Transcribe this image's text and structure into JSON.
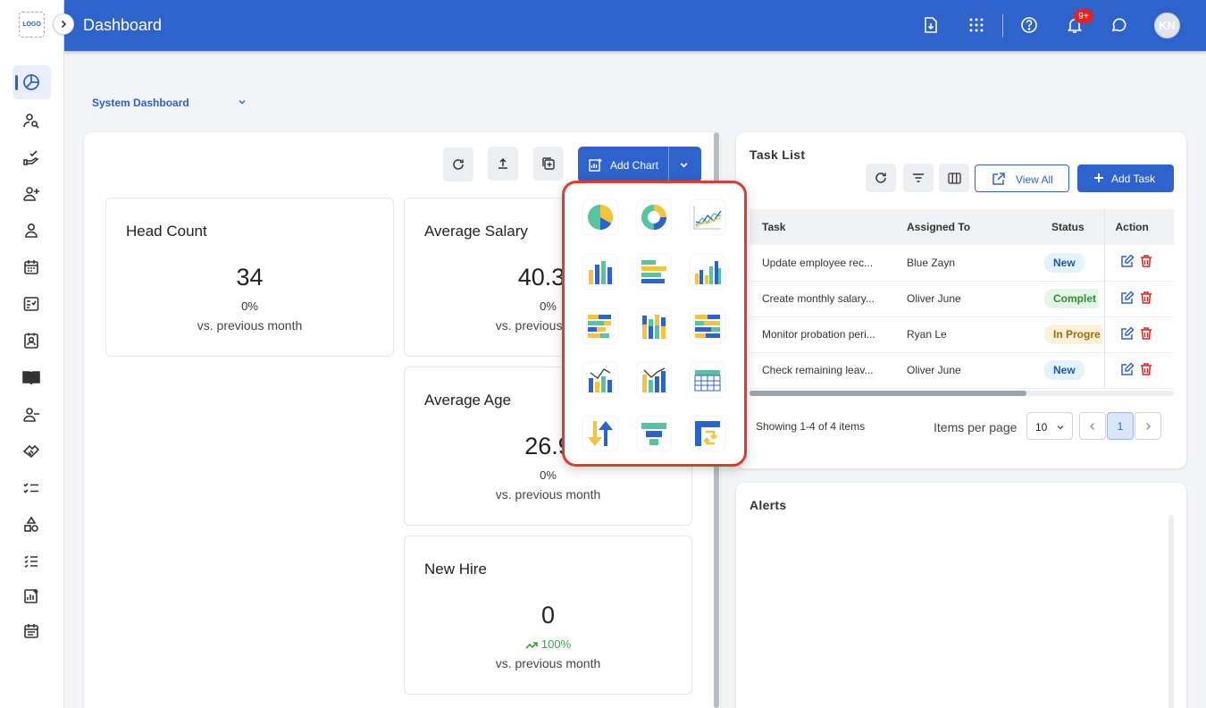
{
  "app": {
    "logo_text": "LOGO",
    "page_title": "Dashboard",
    "notification_count": "9+",
    "avatar_initials": "KN",
    "accent_color": "#2f63cc"
  },
  "sidebar": {
    "items": [
      {
        "name": "dashboard-icon",
        "active": true
      },
      {
        "name": "employee-search-icon"
      },
      {
        "name": "onboarding-icon"
      },
      {
        "name": "add-person-icon"
      },
      {
        "name": "person-icon"
      },
      {
        "name": "calendar-icon"
      },
      {
        "name": "checklist-doc-icon"
      },
      {
        "name": "contact-card-icon"
      },
      {
        "name": "book-icon"
      },
      {
        "name": "remove-person-icon"
      },
      {
        "name": "handshake-icon"
      },
      {
        "name": "task-list-icon"
      },
      {
        "name": "shapes-icon"
      },
      {
        "name": "list-check-icon"
      },
      {
        "name": "chart-add-icon"
      },
      {
        "name": "schedule-icon"
      }
    ]
  },
  "dashboard": {
    "selector_label": "System Dashboard",
    "add_chart_label": "Add Chart",
    "stats": [
      {
        "title": "Head Count",
        "value": "34",
        "pct": "0%",
        "sub": "vs. previous month"
      },
      {
        "title": "Average Salary",
        "value": "40.35",
        "pct": "0%",
        "sub": "vs. previous month"
      },
      {
        "title": "Average Age",
        "value": "26.9",
        "pct": "0%",
        "sub": "vs. previous month"
      },
      {
        "title": "New Hire",
        "value": "0",
        "pct": "100%",
        "sub": "vs. previous month",
        "trend": "up"
      }
    ],
    "chart_options": [
      "pie-chart-icon",
      "donut-chart-icon",
      "line-chart-icon",
      "column-chart-icon",
      "bar-chart-icon",
      "clustered-column-icon",
      "stacked-bar-icon",
      "stacked-column-icon",
      "stacked-bar-100-icon",
      "combo-chart-icon",
      "combo-line-column-icon",
      "table-chart-icon",
      "sort-arrows-icon",
      "funnel-chart-icon",
      "pivot-table-icon"
    ]
  },
  "tasks": {
    "title": "Task List",
    "view_all_label": "View All",
    "add_task_label": "Add Task",
    "columns": [
      "Task",
      "Assigned To",
      "Status",
      "Action"
    ],
    "rows": [
      {
        "task": "Update employee rec...",
        "assigned": "Blue Zayn",
        "status": "New",
        "status_type": "new"
      },
      {
        "task": "Create monthly salary...",
        "assigned": "Oliver June",
        "status": "Complet",
        "status_type": "comp"
      },
      {
        "task": "Monitor probation peri...",
        "assigned": "Ryan Le",
        "status": "In Progre",
        "status_type": "prog"
      },
      {
        "task": "Check remaining leav...",
        "assigned": "Oliver June",
        "status": "New",
        "status_type": "new"
      }
    ],
    "showing": "Showing 1-4 of 4 items",
    "per_page_label": "Items per page",
    "per_page_value": "10",
    "current_page": "1"
  },
  "alerts": {
    "title": "Alerts"
  }
}
